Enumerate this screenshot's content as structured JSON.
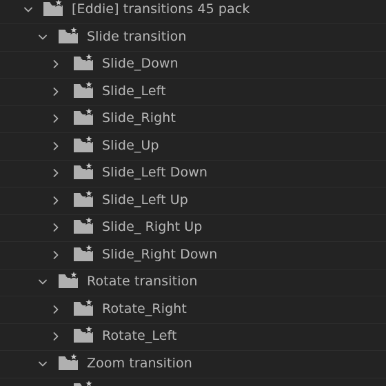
{
  "tree": {
    "root": {
      "label": "[Eddie] transitions 45 pack",
      "expanded": true
    },
    "slide_group": {
      "label": "Slide transition",
      "expanded": true,
      "items": [
        "Slide_Down",
        "Slide_Left",
        "Slide_Right",
        "Slide_Up",
        "Slide_Left Down",
        "Slide_Left Up",
        "Slide_ Right Up",
        "Slide_Right Down"
      ]
    },
    "rotate_group": {
      "label": "Rotate transition",
      "expanded": true,
      "items": [
        "Rotate_Right",
        "Rotate_Left"
      ]
    },
    "zoom_group": {
      "label": "Zoom transition",
      "expanded": true
    }
  },
  "icons": {
    "expanded": "chevron-down-icon",
    "collapsed": "chevron-right-icon",
    "folder": "favorite-folder-icon"
  },
  "colors": {
    "background": "#232323",
    "text": "#b8b8b8",
    "icon": "#b0b0b0"
  }
}
